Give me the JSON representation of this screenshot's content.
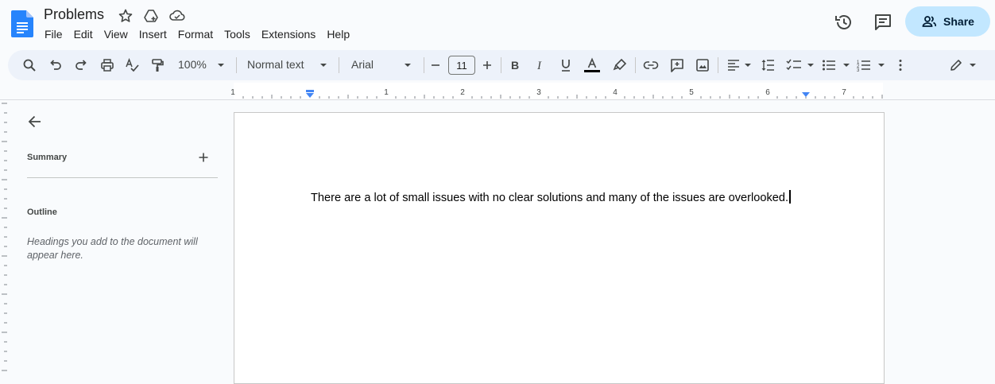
{
  "document": {
    "title": "Problems",
    "body_text": "There are a lot of small issues with no clear solutions and many of the issues are overlooked."
  },
  "menu": [
    "File",
    "Edit",
    "View",
    "Insert",
    "Format",
    "Tools",
    "Extensions",
    "Help"
  ],
  "header": {
    "share_label": "Share"
  },
  "toolbar": {
    "zoom": "100%",
    "paragraph_style": "Normal text",
    "font": "Arial",
    "font_size": "11",
    "icons": [
      "search-icon",
      "undo-icon",
      "redo-icon",
      "print-icon",
      "spellcheck-icon",
      "paint-format-icon",
      "bold-icon",
      "italic-icon",
      "underline-icon",
      "text-color-icon",
      "highlight-icon",
      "link-icon",
      "add-comment-icon",
      "insert-image-icon",
      "align-icon",
      "line-spacing-icon",
      "checklist-icon",
      "bulleted-list-icon",
      "numbered-list-icon",
      "more-icon",
      "editing-mode-icon"
    ]
  },
  "ruler": {
    "labels": [
      "1",
      "1",
      "2",
      "3",
      "4",
      "5",
      "6",
      "7"
    ]
  },
  "sidebar": {
    "summary_label": "Summary",
    "outline_label": "Outline",
    "outline_placeholder": "Headings you add to the document will appear here."
  },
  "colors": {
    "accent": "#1a73e8",
    "share_bg": "#c2e7ff",
    "toolbar_bg": "#edf2fa",
    "app_bg": "#f9fbfd"
  }
}
